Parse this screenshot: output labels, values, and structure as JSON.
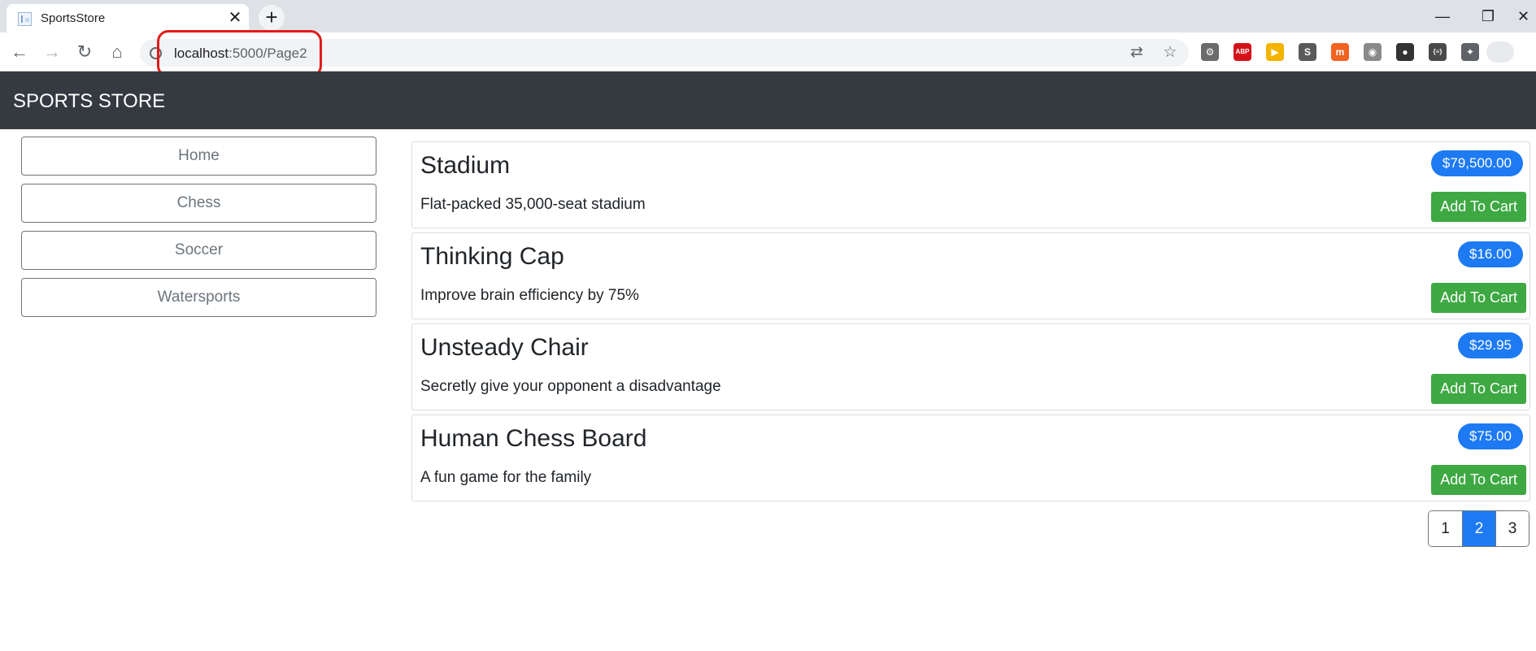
{
  "browser": {
    "tab_title": "SportsStore",
    "tab_close": "✕",
    "new_tab": "+",
    "minimize": "—",
    "restore": "❐",
    "close_window": "✕",
    "url_host": "localhost",
    "url_rest": ":5000/Page2",
    "icons": {
      "back": "←",
      "forward": "→",
      "reload": "↻",
      "home": "⌂",
      "translate": "⇄",
      "star": "☆"
    },
    "extensions": [
      {
        "name": "gear-extension-icon",
        "glyph": "⚙",
        "color": "#6b6b6b"
      },
      {
        "name": "adblock-extension-icon",
        "glyph": "ABP",
        "color": "#d5121a"
      },
      {
        "name": "slides-extension-icon",
        "glyph": "▶",
        "color": "#f4b400"
      },
      {
        "name": "s-extension-icon",
        "glyph": "S",
        "color": "#5a5a5a"
      },
      {
        "name": "magento-extension-icon",
        "glyph": "m",
        "color": "#f26322"
      },
      {
        "name": "wifi-extension-icon",
        "glyph": "◉",
        "color": "#8a8a8a"
      },
      {
        "name": "balls-extension-icon",
        "glyph": "●",
        "color": "#333333"
      },
      {
        "name": "json-extension-icon",
        "glyph": "{≡}",
        "color": "#4a4a4a"
      },
      {
        "name": "puzzle-extension-icon",
        "glyph": "✦",
        "color": "#5f6368"
      }
    ]
  },
  "navbar": {
    "brand": "SPORTS STORE"
  },
  "sidebar": {
    "categories": [
      "Home",
      "Chess",
      "Soccer",
      "Watersports"
    ]
  },
  "products": [
    {
      "name": "Stadium",
      "description": "Flat-packed 35,000-seat stadium",
      "price": "$79,500.00",
      "button": "Add To Cart"
    },
    {
      "name": "Thinking Cap",
      "description": "Improve brain efficiency by 75%",
      "price": "$16.00",
      "button": "Add To Cart"
    },
    {
      "name": "Unsteady Chair",
      "description": "Secretly give your opponent a disadvantage",
      "price": "$29.95",
      "button": "Add To Cart"
    },
    {
      "name": "Human Chess Board",
      "description": "A fun game for the family",
      "price": "$75.00",
      "button": "Add To Cart"
    }
  ],
  "pagination": {
    "pages": [
      "1",
      "2",
      "3"
    ],
    "active": "2"
  },
  "colors": {
    "navbar": "#343a40",
    "price_badge": "#1d7af3",
    "add_button": "#3ea843",
    "annotation": "#e01b1b"
  }
}
